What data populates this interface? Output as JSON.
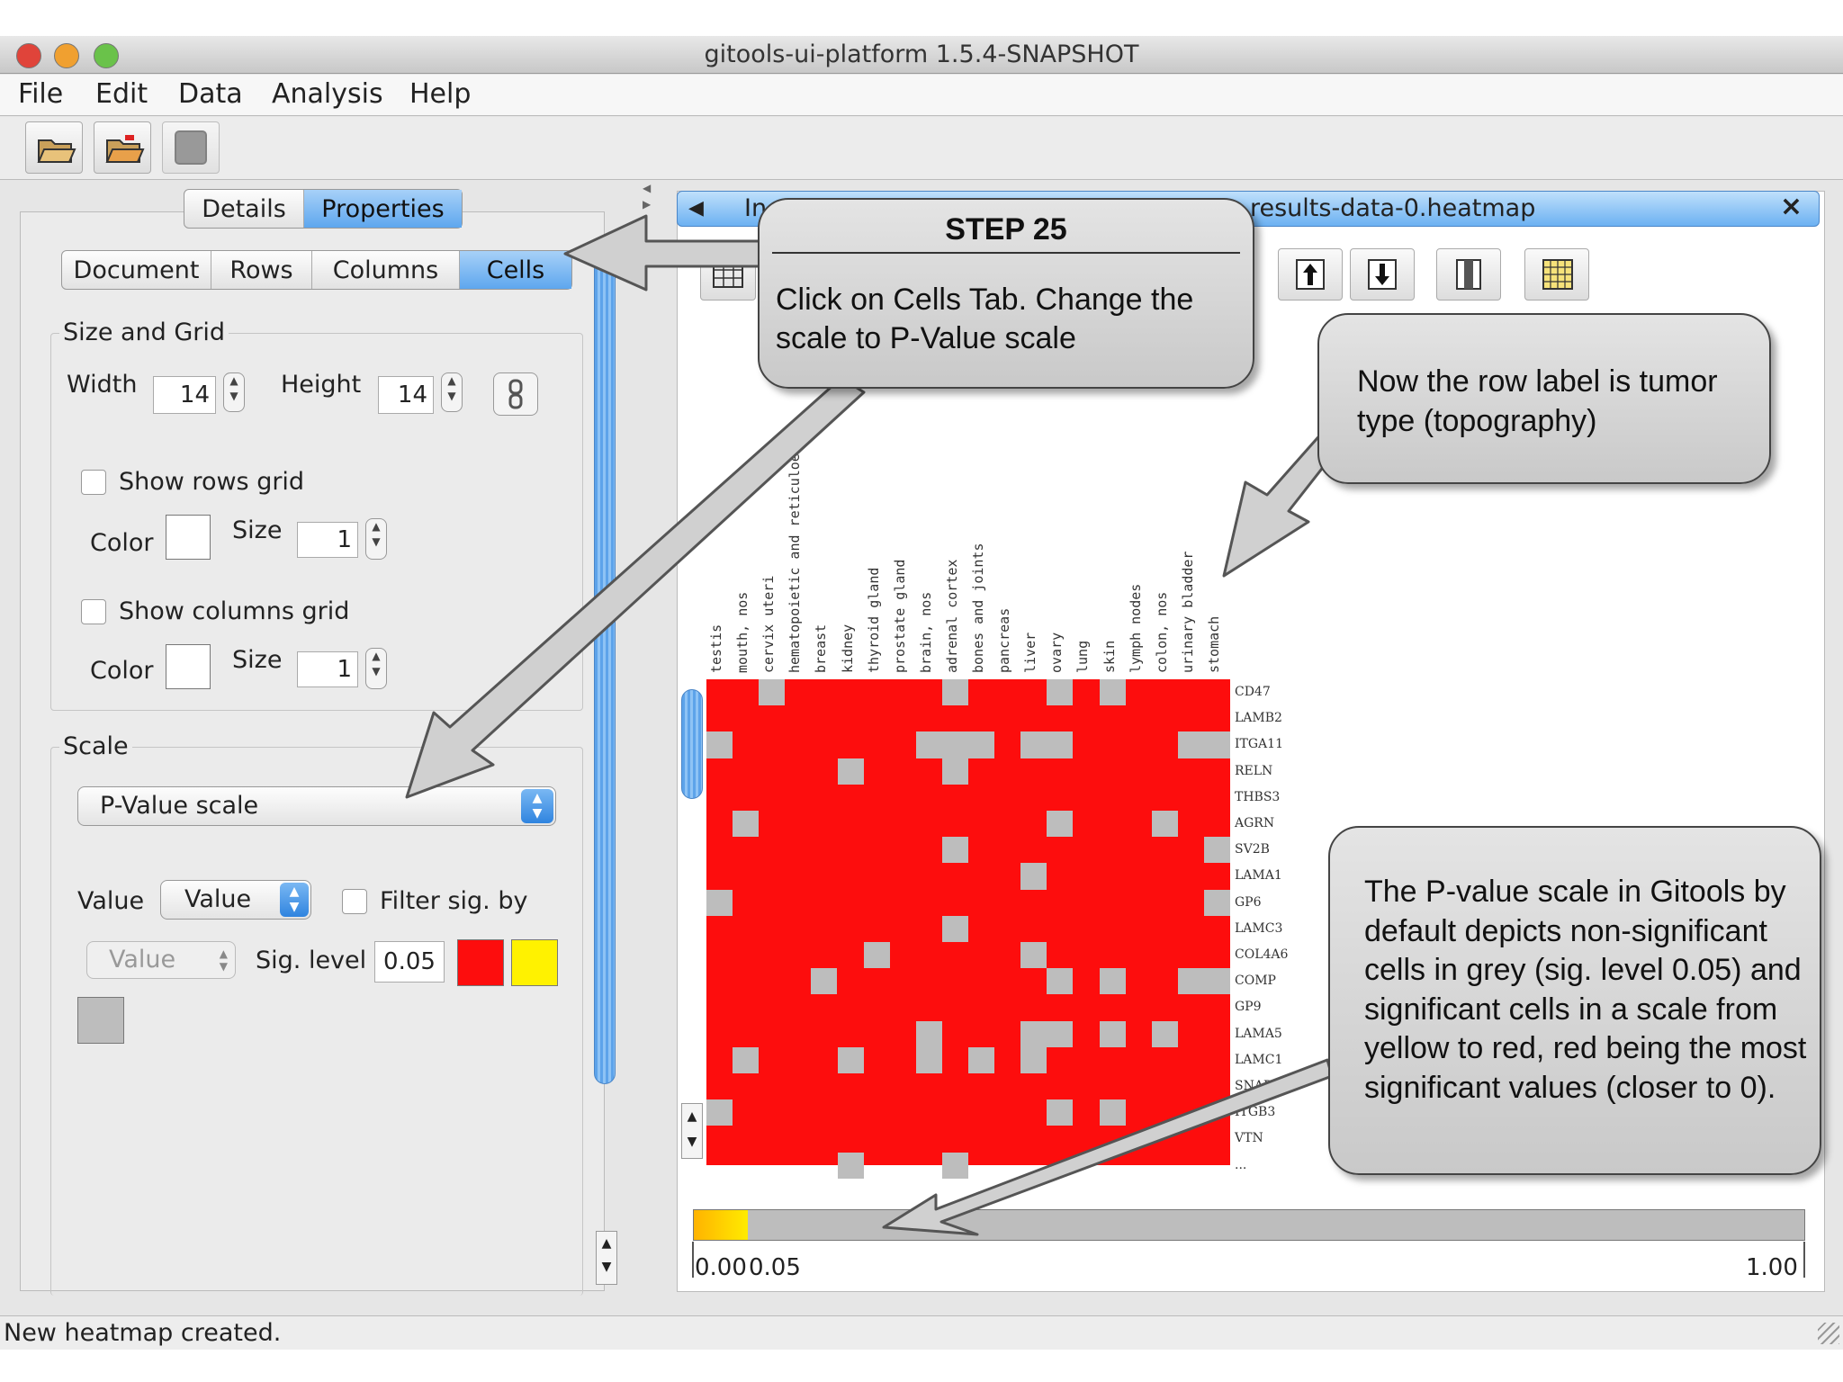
{
  "window": {
    "title": "gitools-ui-platform 1.5.4-SNAPSHOT"
  },
  "menu": [
    "File",
    "Edit",
    "Data",
    "Analysis",
    "Help"
  ],
  "toolbar": {
    "icons": [
      "open-folder-icon",
      "open-folder-icon",
      "save-icon"
    ]
  },
  "left_tabs": [
    "Details",
    "Properties"
  ],
  "sub_tabs": [
    "Document",
    "Rows",
    "Columns",
    "Cells"
  ],
  "size_grid": {
    "title": "Size and Grid",
    "width_label": "Width",
    "width_value": "14",
    "height_label": "Height",
    "height_value": "14",
    "show_rows_grid": "Show rows grid",
    "show_columns_grid": "Show columns grid",
    "color_label": "Color",
    "size_label": "Size",
    "size_value": "1"
  },
  "scale": {
    "title": "Scale",
    "selected": "P-Value scale",
    "value_label": "Value",
    "value_select": "Value",
    "filter_label": "Filter sig. by",
    "filter_select": "Value",
    "sig_level_label": "Sig. level",
    "sig_level": "0.05",
    "colors": {
      "significant": "#fd0d0d",
      "near_threshold": "#fff200",
      "non_significant": "#bdbdbd"
    }
  },
  "document_tab": {
    "left_text": "In",
    "right_text": "results-data-0.heatmap",
    "close": "×"
  },
  "heatmap": {
    "columns": [
      "testis",
      "mouth, nos",
      "cervix uteri",
      "hematopoietic and reticuloendo",
      "breast",
      "kidney",
      "thyroid gland",
      "prostate gland",
      "brain, nos",
      "adrenal cortex",
      "bones and joints",
      "pancreas",
      "liver",
      "ovary",
      "lung",
      "skin",
      "lymph nodes",
      "colon, nos",
      "urinary bladder",
      "stomach"
    ],
    "rows": [
      "CD47",
      "LAMB2",
      "ITGA11",
      "RELN",
      "THBS3",
      "AGRN",
      "SV2B",
      "LAMA1",
      "GP6",
      "LAMC3",
      "COL4A6",
      "COMP",
      "GP9",
      "LAMA5",
      "LAMC1",
      "SNAD",
      "ITGB3",
      "VTN",
      "..."
    ]
  },
  "scale_bar": {
    "ticks": [
      "0.00",
      "0.05",
      "1.00"
    ]
  },
  "callouts": {
    "step_title": "STEP 25",
    "step_text": "Click on Cells Tab. Change the scale to P-Value scale",
    "row_label_text": "Now the row label is tumor type (topography)",
    "pvalue_text": "The P-value scale in Gitools by default depicts non-significant cells in grey (sig. level 0.05) and significant cells in a scale from yellow to red, red being the most significant values (closer to 0)."
  },
  "status": "New heatmap created."
}
